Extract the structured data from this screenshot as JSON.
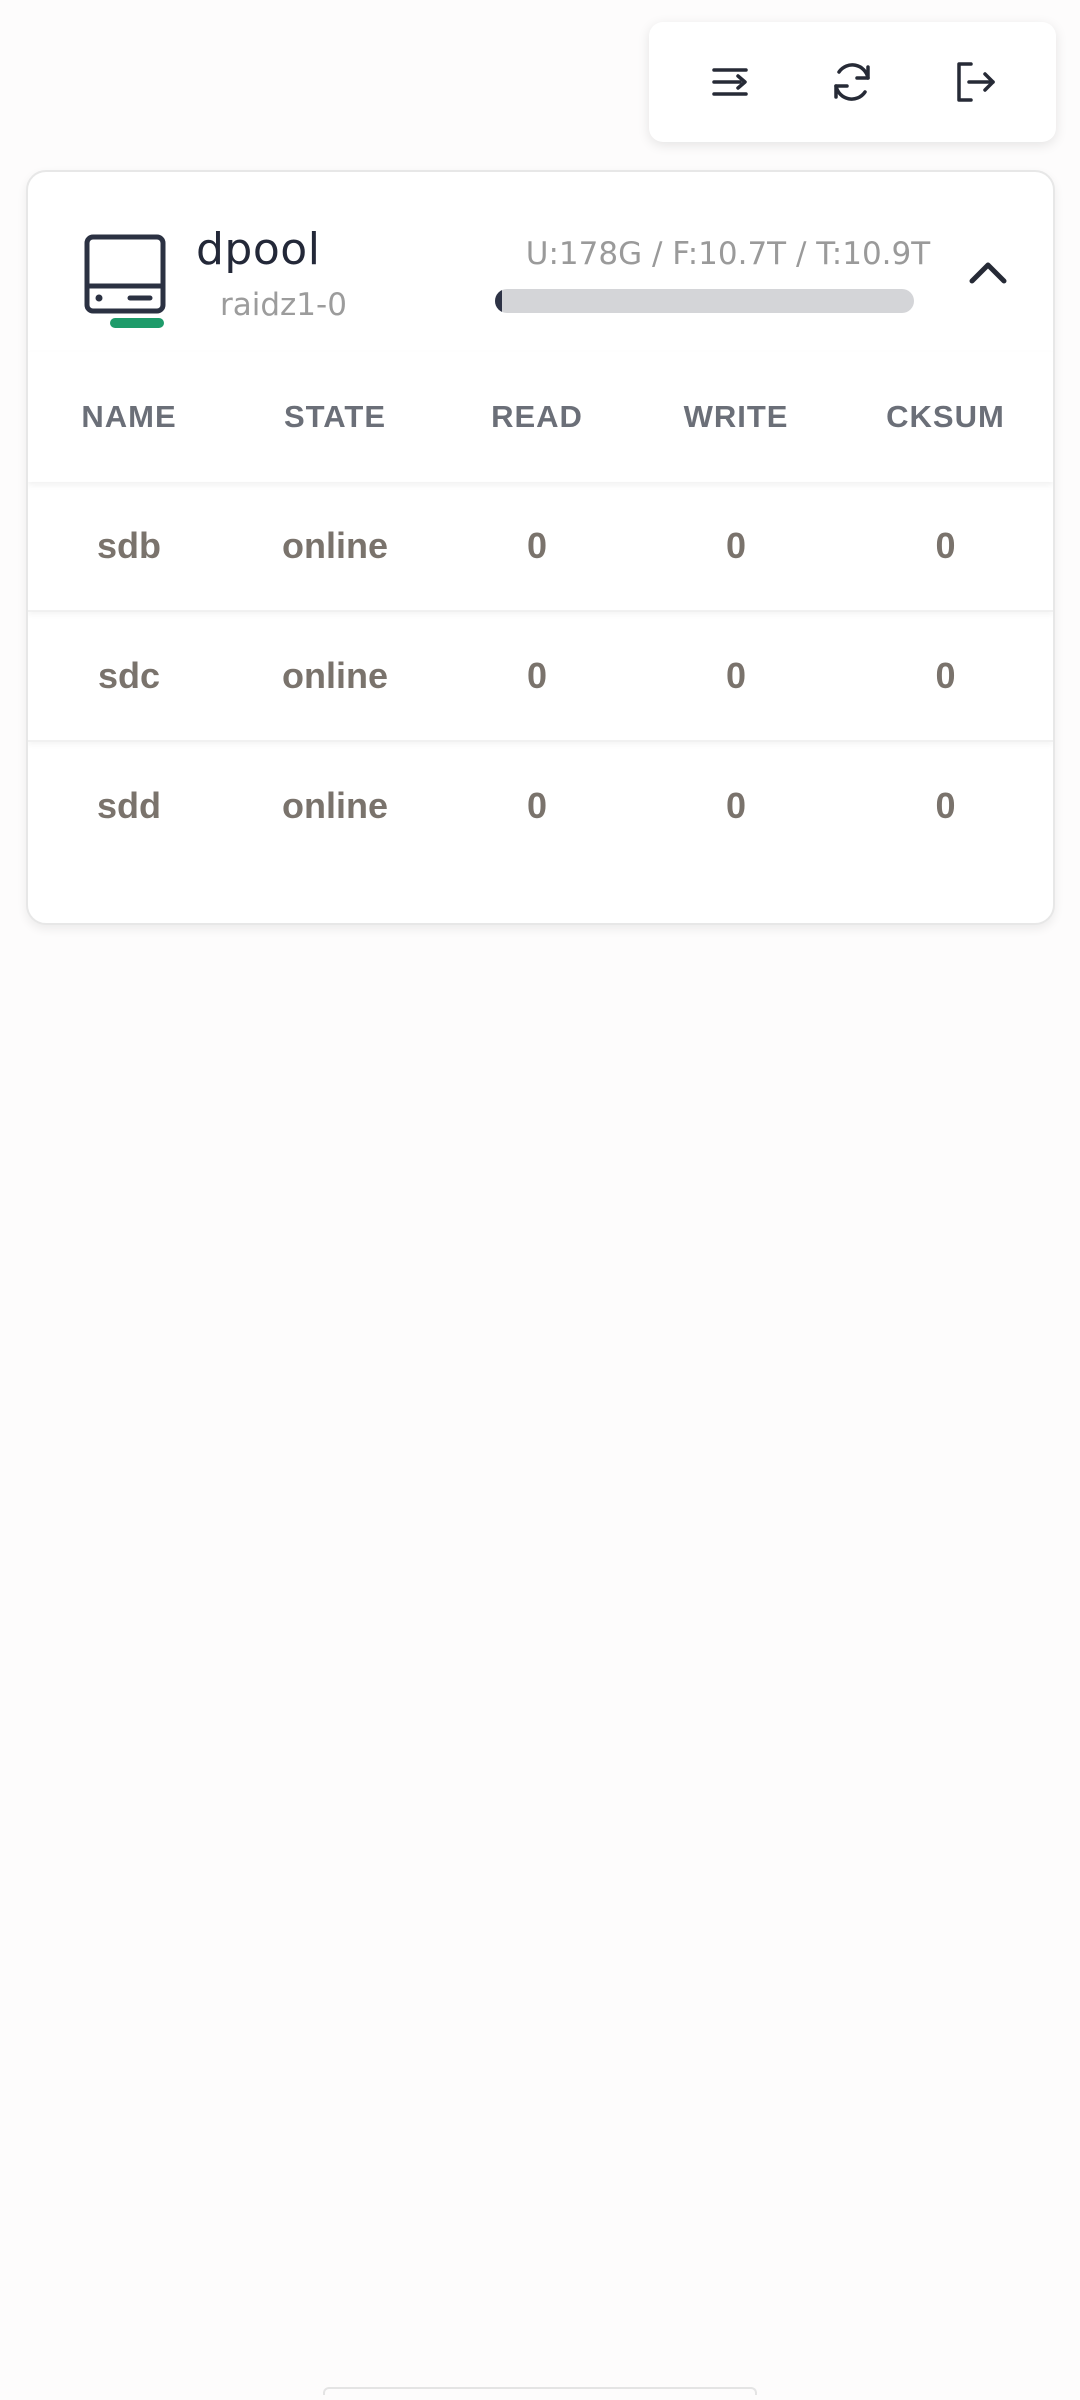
{
  "toolbar": {
    "buttons": [
      {
        "icon": "sort-lines-icon"
      },
      {
        "icon": "refresh-icon"
      },
      {
        "icon": "logout-icon"
      }
    ]
  },
  "pool": {
    "name": "dpool",
    "vdev": "raidz1-0",
    "usage_text": "U:178G / F:10.7T / T:10.9T",
    "usage_fraction": 0.016,
    "status_color": "#1e9b6a",
    "expanded": true
  },
  "table": {
    "columns": [
      "NAME",
      "STATE",
      "READ",
      "WRITE",
      "CKSUM"
    ],
    "rows": [
      [
        "sdb",
        "online",
        "0",
        "0",
        "0"
      ],
      [
        "sdc",
        "online",
        "0",
        "0",
        "0"
      ],
      [
        "sdd",
        "online",
        "0",
        "0",
        "0"
      ]
    ]
  }
}
